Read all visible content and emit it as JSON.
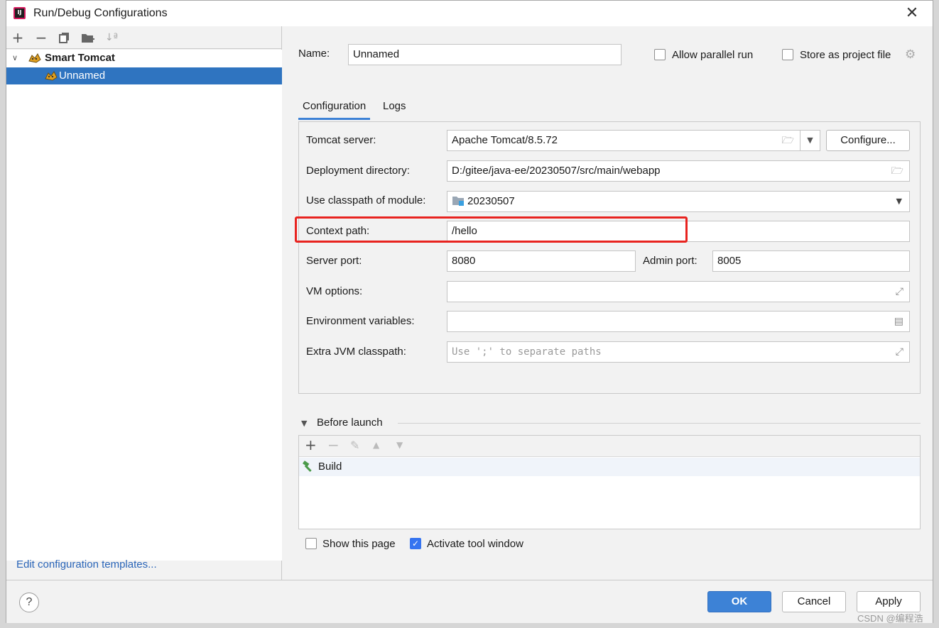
{
  "window": {
    "title": "Run/Debug Configurations",
    "app_icon_text": "IJ"
  },
  "left_toolbar": {
    "add_icon": "+",
    "remove_icon": "−",
    "copy_icon": "copy-icon",
    "folder_icon": "new-folder-icon",
    "sort_icon": "sort-icon"
  },
  "tree": {
    "group": {
      "label": "Smart Tomcat",
      "expanded": true
    },
    "item": {
      "label": "Unnamed",
      "selected": true
    }
  },
  "edit_templates_link": "Edit configuration templates...",
  "name_field": {
    "label": "Name:",
    "value": "Unnamed"
  },
  "allow_parallel": {
    "label": "Allow parallel run",
    "checked": false
  },
  "store_project": {
    "label": "Store as project file",
    "checked": false
  },
  "tabs": [
    {
      "label": "Configuration",
      "active": true
    },
    {
      "label": "Logs",
      "active": false
    }
  ],
  "config": {
    "tomcat_server": {
      "label": "Tomcat server:",
      "value": "Apache Tomcat/8.5.72"
    },
    "configure_button": "Configure...",
    "deployment_dir": {
      "label": "Deployment directory:",
      "value": "D:/gitee/java-ee/20230507/src/main/webapp"
    },
    "classpath_module": {
      "label": "Use classpath of module:",
      "value": "20230507"
    },
    "context_path": {
      "label": "Context path:",
      "value": "/hello"
    },
    "server_port": {
      "label": "Server port:",
      "value": "8080"
    },
    "admin_port": {
      "label": "Admin port:",
      "value": "8005"
    },
    "vm_options": {
      "label": "VM options:",
      "value": ""
    },
    "env_vars": {
      "label": "Environment variables:",
      "value": ""
    },
    "extra_jvm": {
      "label": "Extra JVM classpath:",
      "placeholder": "Use ';' to separate paths"
    }
  },
  "before_launch": {
    "title": "Before launch",
    "tasks": [
      {
        "label": "Build",
        "icon": "hammer-icon"
      }
    ]
  },
  "show_page": {
    "label": "Show this page",
    "checked": false
  },
  "activate_tool": {
    "label": "Activate tool window",
    "checked": true
  },
  "footer": {
    "help": "?",
    "ok": "OK",
    "cancel": "Cancel",
    "apply": "Apply"
  },
  "watermark": "CSDN @编程浩",
  "colors": {
    "accent": "#3d82d6",
    "selection": "#2f74c0",
    "highlight_box": "#e8231f",
    "link": "#2a65b8"
  }
}
